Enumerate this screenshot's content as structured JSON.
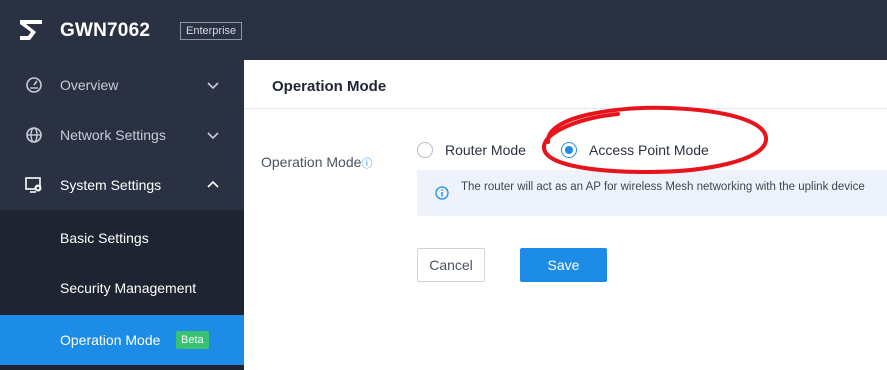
{
  "header": {
    "model": "GWN7062",
    "edition": "Enterprise"
  },
  "sidebar": {
    "items": [
      {
        "label": "Overview"
      },
      {
        "label": "Network Settings"
      },
      {
        "label": "System Settings"
      }
    ],
    "sub_items": [
      {
        "label": "Basic Settings"
      },
      {
        "label": "Security Management"
      },
      {
        "label": "Operation Mode",
        "badge": "Beta"
      }
    ]
  },
  "main": {
    "title": "Operation Mode",
    "field_label": "Operation Mode",
    "field_info": "ⓘ",
    "options": [
      {
        "label": "Router Mode",
        "selected": false
      },
      {
        "label": "Access Point Mode",
        "selected": true
      }
    ],
    "hint": "The router will act as an AP for wireless Mesh networking with the uplink device",
    "cancel_label": "Cancel",
    "save_label": "Save"
  },
  "colors": {
    "sidebar_bg": "#2a3142",
    "accent": "#1c8ce6",
    "badge": "#38c172",
    "annotation": "#e8141c"
  }
}
